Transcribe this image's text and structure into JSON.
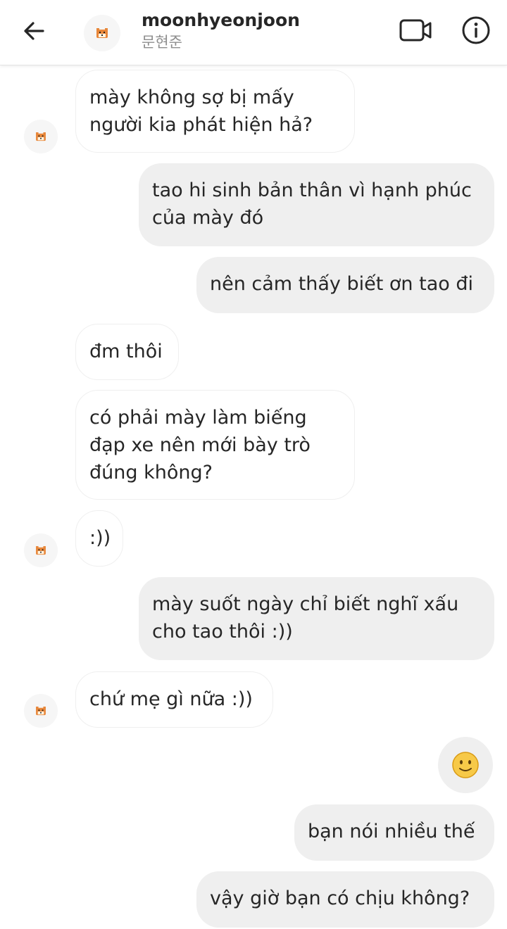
{
  "header": {
    "username": "moonhyeonjoon",
    "subname": "문현준",
    "icons": {
      "back": "arrow-left-icon",
      "video": "video-call-icon",
      "info": "info-icon",
      "avatar": "tiger-avatar-icon"
    }
  },
  "messages": [
    {
      "side": "in",
      "text": "mày không sợ bị mấy người kia phát hiện hả?"
    },
    {
      "side": "out",
      "text": "tao hi sinh bản thân vì hạnh phúc của mày đó"
    },
    {
      "side": "out",
      "text": "nên cảm thấy biết ơn tao đi"
    },
    {
      "side": "in",
      "text": "đm thôi"
    },
    {
      "side": "in",
      "text": "có phải mày làm biếng đạp xe nên mới bày trò đúng không?"
    },
    {
      "side": "in",
      "text": ":))"
    },
    {
      "side": "out",
      "text": "mày suốt ngày chỉ biết nghĩ xấu cho tao thôi :))"
    },
    {
      "side": "in",
      "text": "chứ mẹ gì nữa :))"
    },
    {
      "side": "out",
      "emoji": "slightly-smiling-face",
      "text": "🙂"
    },
    {
      "side": "out",
      "text": "bạn nói nhiều thế"
    },
    {
      "side": "out",
      "text": "vậy giờ bạn có chịu không?"
    }
  ]
}
